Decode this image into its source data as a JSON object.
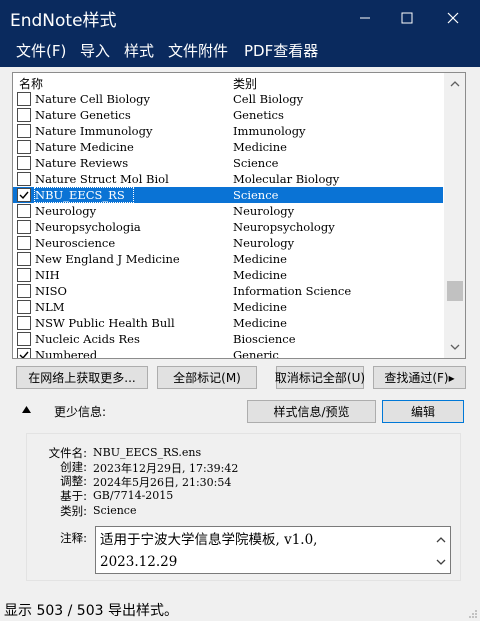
{
  "window": {
    "title": "EndNote样式",
    "minimize_glyph": "—",
    "maximize_glyph": "☐",
    "close_glyph": "✕"
  },
  "menu": [
    "文件(F)",
    "导入",
    "样式",
    "文件附件",
    "PDF查看器"
  ],
  "list": {
    "header_name": "名称",
    "header_category": "类别",
    "rows": [
      {
        "name": "Nature Cell Biology",
        "category": "Cell Biology",
        "checked": false,
        "selected": false
      },
      {
        "name": "Nature Genetics",
        "category": "Genetics",
        "checked": false,
        "selected": false
      },
      {
        "name": "Nature Immunology",
        "category": "Immunology",
        "checked": false,
        "selected": false
      },
      {
        "name": "Nature Medicine",
        "category": "Medicine",
        "checked": false,
        "selected": false
      },
      {
        "name": "Nature Reviews",
        "category": "Science",
        "checked": false,
        "selected": false
      },
      {
        "name": "Nature Struct Mol Biol",
        "category": "Molecular Biology",
        "checked": false,
        "selected": false
      },
      {
        "name": "NBU_EECS_RS",
        "category": "Science",
        "checked": true,
        "selected": true
      },
      {
        "name": "Neurology",
        "category": "Neurology",
        "checked": false,
        "selected": false
      },
      {
        "name": "Neuropsychologia",
        "category": "Neuropsychology",
        "checked": false,
        "selected": false
      },
      {
        "name": "Neuroscience",
        "category": "Neurology",
        "checked": false,
        "selected": false
      },
      {
        "name": "New England J Medicine",
        "category": "Medicine",
        "checked": false,
        "selected": false
      },
      {
        "name": "NIH",
        "category": "Medicine",
        "checked": false,
        "selected": false
      },
      {
        "name": "NISO",
        "category": "Information Science",
        "checked": false,
        "selected": false
      },
      {
        "name": "NLM",
        "category": "Medicine",
        "checked": false,
        "selected": false
      },
      {
        "name": "NSW Public Health Bull",
        "category": "Medicine",
        "checked": false,
        "selected": false
      },
      {
        "name": "Nucleic Acids Res",
        "category": "Bioscience",
        "checked": false,
        "selected": false
      },
      {
        "name": "Numbered",
        "category": "Generic",
        "checked": true,
        "selected": false
      }
    ]
  },
  "buttons": {
    "get_more": "在网络上获取更多...",
    "mark_all": "全部标记(M)",
    "unmark_all": "取消标记全部(U)",
    "find_by": "查找通过(F)▸",
    "style_info": "样式信息/预览",
    "edit": "编辑"
  },
  "less_info": "更少信息:",
  "info": {
    "filename_label": "文件名:",
    "filename": "NBU_EECS_RS.ens",
    "created_label": "创建:",
    "created": "2023年12月29日, 17:39:42",
    "modified_label": "调整:",
    "modified": "2024年5月26日, 21:30:54",
    "based_label": "基于:",
    "based": "GB/7714-2015",
    "category_label": "类别:",
    "category": "Science",
    "comment_label": "注释:",
    "comment_line1": "适用于宁波大学信息学院模板, v1.0,",
    "comment_line2": "2023.12.29"
  },
  "status": "显示 503 / 503 导出样式。"
}
